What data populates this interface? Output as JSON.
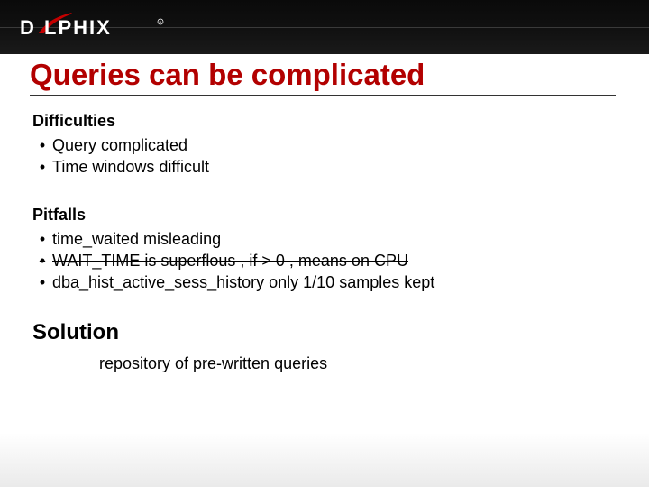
{
  "brand": {
    "name": "DELPHIX"
  },
  "title": "Queries can be complicated",
  "sections": {
    "difficulties": {
      "heading": "Difficulties",
      "items": [
        "Query complicated",
        "Time windows difficult"
      ]
    },
    "pitfalls": {
      "heading": "Pitfalls",
      "items": [
        {
          "text": "time_waited misleading",
          "strike": false
        },
        {
          "text": "WAIT_TIME  is  superflous , if   >  0 , means on CPU",
          "strike": true
        },
        {
          "text": "dba_hist_active_sess_history  only 1/10 samples kept",
          "strike": false
        }
      ]
    },
    "solution": {
      "heading": "Solution",
      "body": "repository of pre-written queries"
    }
  }
}
